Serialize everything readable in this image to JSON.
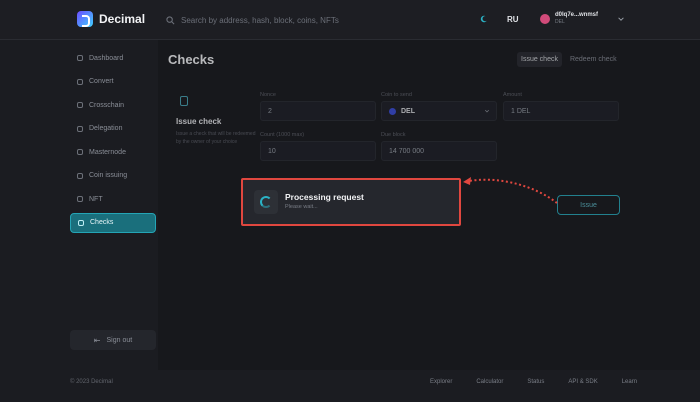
{
  "app": {
    "name": "Decimal"
  },
  "header": {
    "search_placeholder": "Search by address, hash, block, coins, NFTs",
    "language": "RU",
    "account": {
      "address": "d0lq7e...wnmsf",
      "subtitle": "DEL"
    }
  },
  "sidebar": {
    "items": [
      {
        "label": "Dashboard",
        "active": false
      },
      {
        "label": "Convert",
        "active": false
      },
      {
        "label": "Crosschain",
        "active": false
      },
      {
        "label": "Delegation",
        "active": false
      },
      {
        "label": "Masternode",
        "active": false
      },
      {
        "label": "Coin issuing",
        "active": false
      },
      {
        "label": "NFT",
        "active": false
      },
      {
        "label": "Checks",
        "active": true
      }
    ],
    "signout_label": "Sign out"
  },
  "main": {
    "title": "Checks",
    "tabs": [
      {
        "label": "Issue check",
        "active": true
      },
      {
        "label": "Redeem check",
        "active": false
      }
    ],
    "card": {
      "title": "Issue check",
      "description": "Issue a check that will be redeemed by the owner of your choice"
    },
    "form": {
      "nonce": {
        "label": "Nonce",
        "value": "2"
      },
      "coin": {
        "label": "Coin to send",
        "value": "DEL"
      },
      "amount": {
        "label": "Amount",
        "value": "1 DEL"
      },
      "count": {
        "label": "Count (1000 max)",
        "value": "10"
      },
      "due_block": {
        "label": "Due block",
        "value": "14 700 000"
      }
    },
    "issue_button": "Issue"
  },
  "modal": {
    "title": "Processing request",
    "subtitle": "Please wait..."
  },
  "footer": {
    "copyright": "© 2023 Decimal",
    "links": [
      "Explorer",
      "Calculator",
      "Status",
      "API & SDK",
      "Learn"
    ]
  },
  "colors": {
    "accent": "#2aa7b9",
    "highlight": "#e0473f",
    "background": "#1b1c21"
  }
}
